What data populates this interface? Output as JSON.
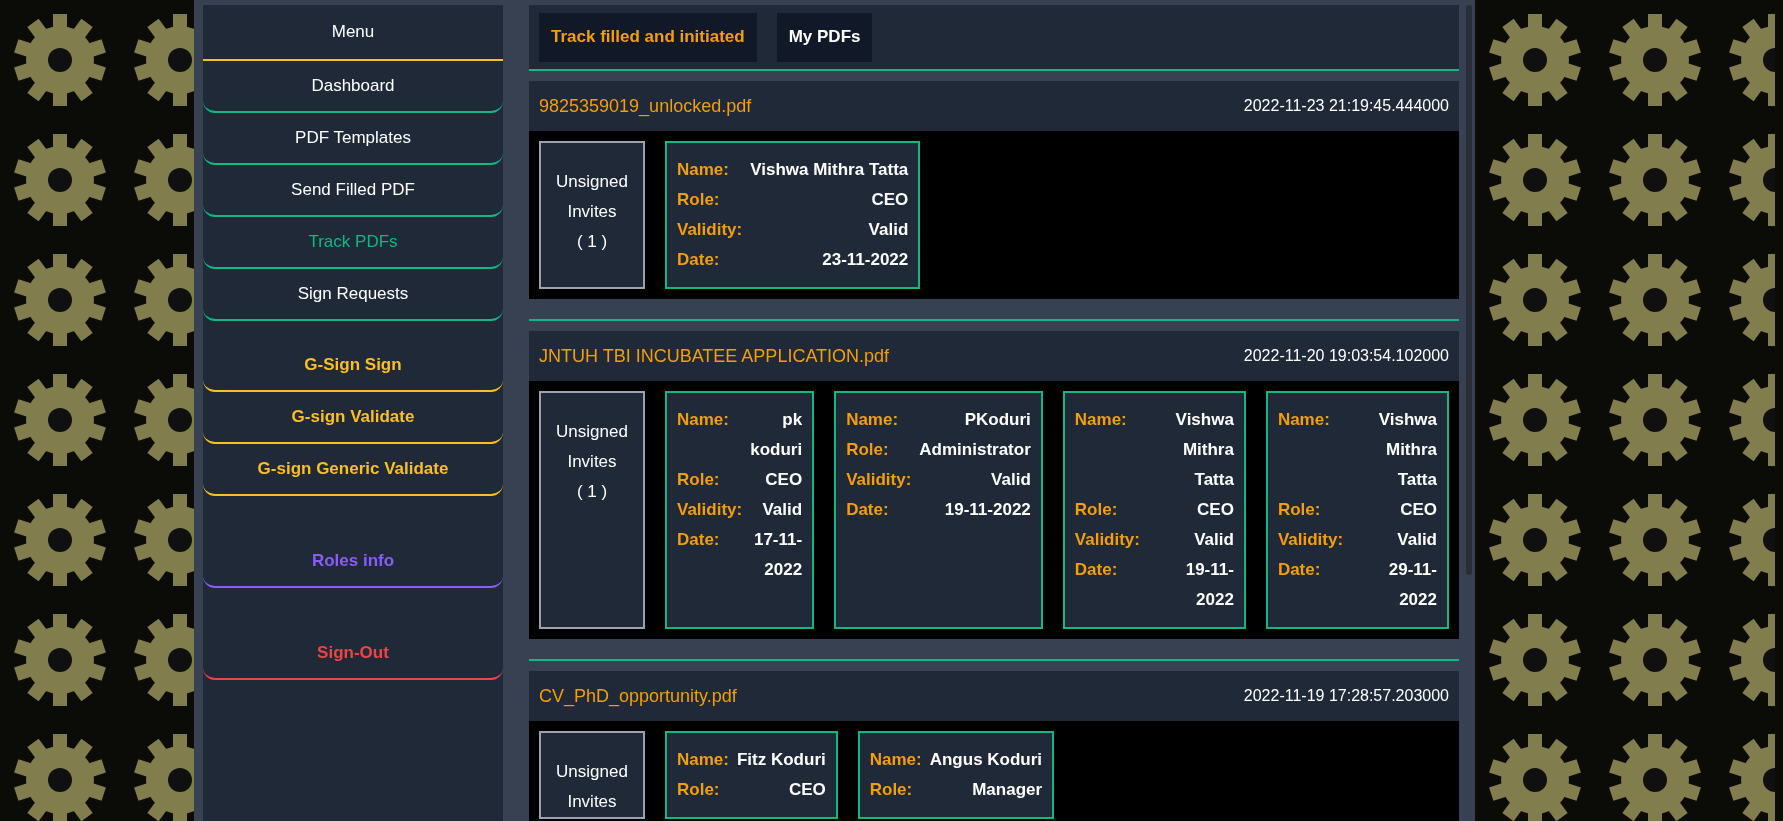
{
  "sidebar": {
    "title": "Menu",
    "groups": [
      {
        "kind": "nav",
        "items": [
          {
            "label": "Dashboard",
            "selected": false,
            "color": "#10b981"
          },
          {
            "label": "PDF Templates",
            "selected": false,
            "color": "#10b981"
          },
          {
            "label": "Send Filled PDF",
            "selected": false,
            "color": "#10b981"
          },
          {
            "label": "Track PDFs",
            "selected": true,
            "color": "#10b981"
          },
          {
            "label": "Sign Requests",
            "selected": false,
            "color": "#10b981"
          }
        ]
      },
      {
        "kind": "accent",
        "items": [
          {
            "label": "G-Sign Sign",
            "color": "#fbbf24"
          },
          {
            "label": "G-sign Validate",
            "color": "#fbbf24"
          },
          {
            "label": "G-sign Generic Validate",
            "color": "#fbbf24"
          }
        ]
      },
      {
        "kind": "accent",
        "items": [
          {
            "label": "Roles info",
            "color": "#8b5cf6"
          }
        ]
      },
      {
        "kind": "accent",
        "items": [
          {
            "label": "Sign-Out",
            "color": "#ef4444"
          }
        ]
      }
    ]
  },
  "tabs": [
    {
      "label": "Track filled and initiated",
      "selected": true
    },
    {
      "label": "My PDFs",
      "selected": false
    }
  ],
  "documents": [
    {
      "file": "9825359019_unlocked.pdf",
      "timestamp": "2022-11-23 21:19:45.444000",
      "unsigned": {
        "label": "Unsigned Invites",
        "count": "( 1 )"
      },
      "signers": [
        {
          "fields": [
            {
              "label": "Name:",
              "value": "Vishwa Mithra Tatta"
            },
            {
              "label": "Role:",
              "value": "CEO"
            },
            {
              "label": "Validity:",
              "value": "Valid"
            },
            {
              "label": "Date:",
              "value": "23-11-2022"
            }
          ]
        }
      ]
    },
    {
      "file": "JNTUH TBI INCUBATEE APPLICATION.pdf",
      "timestamp": "2022-11-20 19:03:54.102000",
      "unsigned": {
        "label": "Unsigned Invites",
        "count": "( 1 )"
      },
      "signers": [
        {
          "fields": [
            {
              "label": "Name:",
              "value": "pk koduri"
            },
            {
              "label": "Role:",
              "value": "CEO"
            },
            {
              "label": "Validity:",
              "value": "Valid"
            },
            {
              "label": "Date:",
              "value": "17-11-2022"
            }
          ]
        },
        {
          "fields": [
            {
              "label": "Name:",
              "value": "PKoduri"
            },
            {
              "label": "Role:",
              "value": "Administrator"
            },
            {
              "label": "Validity:",
              "value": "Valid"
            },
            {
              "label": "Date:",
              "value": "19-11-2022"
            }
          ]
        },
        {
          "fields": [
            {
              "label": "Name:",
              "value": "Vishwa Mithra Tatta"
            },
            {
              "label": "Role:",
              "value": "CEO"
            },
            {
              "label": "Validity:",
              "value": "Valid"
            },
            {
              "label": "Date:",
              "value": "19-11-2022"
            }
          ]
        },
        {
          "fields": [
            {
              "label": "Name:",
              "value": "Vishwa Mithra Tatta"
            },
            {
              "label": "Role:",
              "value": "CEO"
            },
            {
              "label": "Validity:",
              "value": "Valid"
            },
            {
              "label": "Date:",
              "value": "29-11-2022"
            }
          ]
        }
      ]
    },
    {
      "file": "CV_PhD_opportunity.pdf",
      "timestamp": "2022-11-19 17:28:57.203000",
      "unsigned": {
        "label": "Unsigned Invites"
      },
      "signers": [
        {
          "fields": [
            {
              "label": "Name:",
              "value": "Fitz Koduri"
            },
            {
              "label": "Role:",
              "value": "CEO"
            }
          ]
        },
        {
          "fields": [
            {
              "label": "Name:",
              "value": "Angus Koduri"
            },
            {
              "label": "Role:",
              "value": "Manager"
            }
          ]
        }
      ]
    }
  ]
}
